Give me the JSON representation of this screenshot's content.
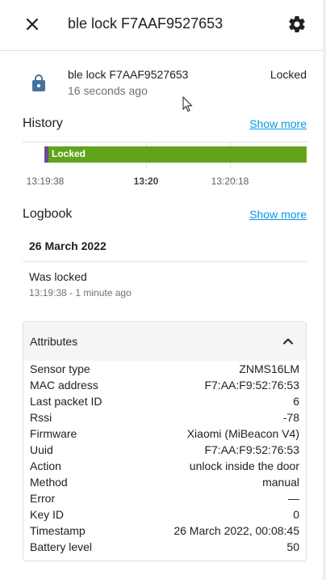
{
  "header": {
    "title": "ble lock F7AAF9527653"
  },
  "entity": {
    "name": "ble lock F7AAF9527653",
    "last_changed": "16 seconds ago",
    "state": "Locked"
  },
  "history": {
    "title": "History",
    "show_more": "Show more",
    "bar_label": "Locked",
    "bar_color": "#62a31c",
    "ticks": [
      "13:19:38",
      "13:20",
      "13:20:18"
    ]
  },
  "logbook": {
    "title": "Logbook",
    "show_more": "Show more",
    "date": "26 March 2022",
    "entry": {
      "message": "Was locked",
      "time": "13:19:38 - 1 minute ago"
    }
  },
  "attributes": {
    "title": "Attributes",
    "items": [
      {
        "key": "Sensor type",
        "value": "ZNMS16LM"
      },
      {
        "key": "MAC address",
        "value": "F7:AA:F9:52:76:53"
      },
      {
        "key": "Last packet ID",
        "value": "6"
      },
      {
        "key": "Rssi",
        "value": "-78"
      },
      {
        "key": "Firmware",
        "value": "Xiaomi (MiBeacon V4)"
      },
      {
        "key": "Uuid",
        "value": "F7:AA:F9:52:76:53"
      },
      {
        "key": "Action",
        "value": "unlock inside the door"
      },
      {
        "key": "Method",
        "value": "manual"
      },
      {
        "key": "Error",
        "value": "—"
      },
      {
        "key": "Key ID",
        "value": "0"
      },
      {
        "key": "Timestamp",
        "value": "26 March 2022, 00:08:45"
      },
      {
        "key": "Battery level",
        "value": "50"
      }
    ]
  },
  "icons": {
    "close": "close-icon",
    "settings": "gear-icon",
    "entity": "lock-icon",
    "collapse": "chevron-up-icon"
  },
  "colors": {
    "accent": "#039be5",
    "icon": "#44739e",
    "locked": "#62a31c"
  }
}
